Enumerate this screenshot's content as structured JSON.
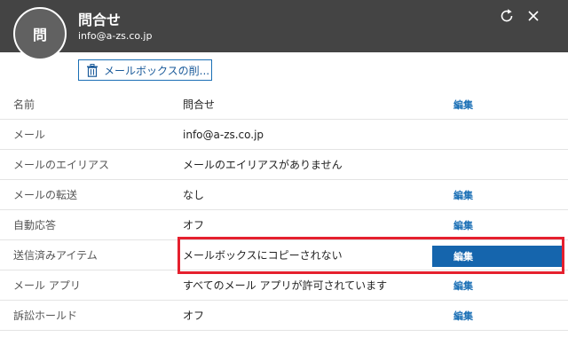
{
  "header": {
    "avatar_initial": "問",
    "title": "問合せ",
    "email": "info@a-zs.co.jp",
    "refresh_icon": "refresh-icon",
    "close_icon": "close-icon"
  },
  "toolbar": {
    "delete_mailbox_label": "メールボックスの削...",
    "delete_icon": "trash-icon"
  },
  "rows": [
    {
      "label": "名前",
      "value": "問合せ",
      "edit": "編集"
    },
    {
      "label": "メール",
      "value": "info@a-zs.co.jp",
      "edit": ""
    },
    {
      "label": "メールのエイリアス",
      "value": "メールのエイリアスがありません",
      "edit": ""
    },
    {
      "label": "メールの転送",
      "value": "なし",
      "edit": "編集"
    },
    {
      "label": "自動応答",
      "value": "オフ",
      "edit": "編集"
    },
    {
      "label": "送信済みアイテム",
      "value": "メールボックスにコピーされない",
      "edit": "編集"
    },
    {
      "label": "メール アプリ",
      "value": "すべてのメール アプリが許可されています",
      "edit": "編集"
    },
    {
      "label": "訴訟ホールド",
      "value": "オフ",
      "edit": "編集"
    }
  ],
  "colors": {
    "header_bg": "#444444",
    "accent": "#1a6fb5",
    "active_button": "#1565ad",
    "highlight": "#e5202e"
  }
}
